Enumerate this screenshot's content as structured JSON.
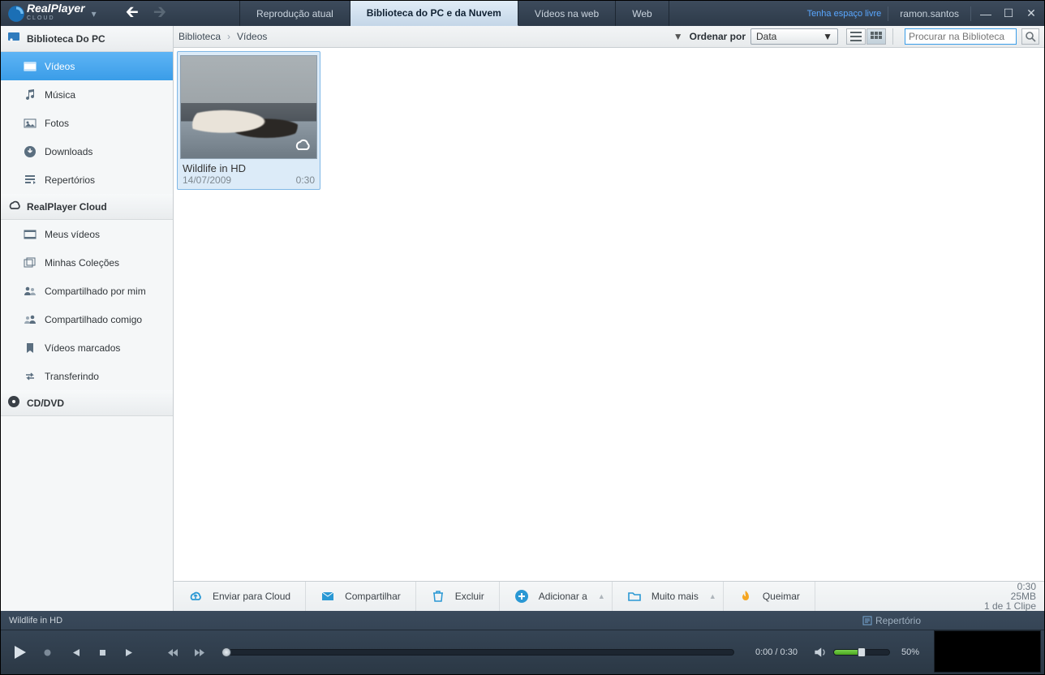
{
  "app": {
    "name": "RealPlayer",
    "sub": "CLOUD"
  },
  "titlebar": {
    "tabs": [
      {
        "label": "Reprodução atual"
      },
      {
        "label": "Biblioteca do PC e da Nuvem",
        "active": true
      },
      {
        "label": "Vídeos na web"
      },
      {
        "label": "Web"
      }
    ],
    "free_space": "Tenha espaço livre",
    "user": "ramon.santos"
  },
  "sidebar": {
    "pc": {
      "header": "Biblioteca Do PC",
      "items": [
        {
          "icon": "video-icon",
          "label": "Vídeos",
          "selected": true
        },
        {
          "icon": "music-icon",
          "label": "Música"
        },
        {
          "icon": "photo-icon",
          "label": "Fotos"
        },
        {
          "icon": "download-icon",
          "label": "Downloads"
        },
        {
          "icon": "playlist-icon",
          "label": "Repertórios"
        }
      ]
    },
    "cloud": {
      "header": "RealPlayer Cloud",
      "items": [
        {
          "icon": "video-icon",
          "label": "Meus vídeos"
        },
        {
          "icon": "collection-icon",
          "label": "Minhas Coleções"
        },
        {
          "icon": "shared-by-icon",
          "label": "Compartilhado por mim"
        },
        {
          "icon": "shared-with-icon",
          "label": "Compartilhado comigo"
        },
        {
          "icon": "bookmark-icon",
          "label": "Vídeos marcados"
        },
        {
          "icon": "transfer-icon",
          "label": "Transferindo"
        }
      ]
    },
    "disc": {
      "header": "CD/DVD"
    }
  },
  "toolbar": {
    "breadcrumb": [
      "Biblioteca",
      "Vídeos"
    ],
    "sort_label": "Ordenar por",
    "sort_value": "Data",
    "search_placeholder": "Procurar na Biblioteca"
  },
  "grid": {
    "items": [
      {
        "title": "Wildlife in HD",
        "date": "14/07/2009",
        "duration": "0:30"
      }
    ]
  },
  "actions": {
    "upload": "Enviar para Cloud",
    "share": "Compartilhar",
    "delete": "Excluir",
    "add": "Adicionar a",
    "more": "Muito mais",
    "burn": "Queimar",
    "info": {
      "dur": "0:30",
      "size": "25MB",
      "count": "1 de 1 Clipe"
    }
  },
  "player": {
    "now_playing": "Wildlife in HD",
    "repertoire": "Repertório",
    "time": "0:00 / 0:30",
    "volume": "50%"
  }
}
